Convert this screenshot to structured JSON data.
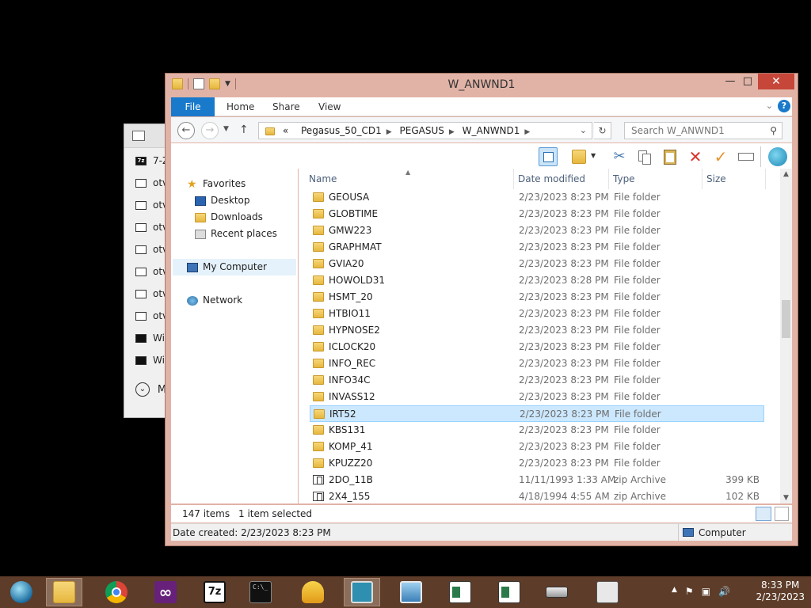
{
  "background_window": {
    "rows": [
      {
        "label": "7-Z",
        "icon": "7zip-icon"
      },
      {
        "label": "otv",
        "icon": "window-icon"
      },
      {
        "label": "otv",
        "icon": "window-icon"
      },
      {
        "label": "otv",
        "icon": "window-icon"
      },
      {
        "label": "otv",
        "icon": "window-icon"
      },
      {
        "label": "otv",
        "icon": "window-icon"
      },
      {
        "label": "otv",
        "icon": "window-icon"
      },
      {
        "label": "otv",
        "icon": "window-icon"
      },
      {
        "label": "Wi",
        "icon": "cmd-icon"
      },
      {
        "label": "Wi",
        "icon": "cmd-icon"
      }
    ],
    "more_label": "M"
  },
  "window": {
    "title": "W_ANWND1",
    "minimize": "—",
    "maximize": "□",
    "close": "✕",
    "accent": "#e1b2a6"
  },
  "ribbon": {
    "tabs": [
      "File",
      "Home",
      "Share",
      "View"
    ],
    "help": "?"
  },
  "address": {
    "overflow": "«",
    "segments": [
      "Pegasus_50_CD1",
      "PEGASUS",
      "W_ANWND1"
    ],
    "search_placeholder": "Search W_ANWND1"
  },
  "nav": {
    "favorites": "Favorites",
    "desktop": "Desktop",
    "downloads": "Downloads",
    "recent": "Recent places",
    "computer": "My Computer",
    "network": "Network"
  },
  "columns": {
    "name": "Name",
    "date": "Date modified",
    "type": "Type",
    "size": "Size"
  },
  "files": [
    {
      "name": "GEOUSA",
      "date": "2/23/2023 8:23 PM",
      "type": "File folder",
      "size": "",
      "kind": "folder"
    },
    {
      "name": "GLOBTIME",
      "date": "2/23/2023 8:23 PM",
      "type": "File folder",
      "size": "",
      "kind": "folder"
    },
    {
      "name": "GMW223",
      "date": "2/23/2023 8:23 PM",
      "type": "File folder",
      "size": "",
      "kind": "folder"
    },
    {
      "name": "GRAPHMAT",
      "date": "2/23/2023 8:23 PM",
      "type": "File folder",
      "size": "",
      "kind": "folder"
    },
    {
      "name": "GVIA20",
      "date": "2/23/2023 8:23 PM",
      "type": "File folder",
      "size": "",
      "kind": "folder"
    },
    {
      "name": "HOWOLD31",
      "date": "2/23/2023 8:28 PM",
      "type": "File folder",
      "size": "",
      "kind": "folder"
    },
    {
      "name": "HSMT_20",
      "date": "2/23/2023 8:23 PM",
      "type": "File folder",
      "size": "",
      "kind": "folder"
    },
    {
      "name": "HTBIO11",
      "date": "2/23/2023 8:23 PM",
      "type": "File folder",
      "size": "",
      "kind": "folder"
    },
    {
      "name": "HYPNOSE2",
      "date": "2/23/2023 8:23 PM",
      "type": "File folder",
      "size": "",
      "kind": "folder"
    },
    {
      "name": "ICLOCK20",
      "date": "2/23/2023 8:23 PM",
      "type": "File folder",
      "size": "",
      "kind": "folder"
    },
    {
      "name": "INFO_REC",
      "date": "2/23/2023 8:23 PM",
      "type": "File folder",
      "size": "",
      "kind": "folder"
    },
    {
      "name": "INFO34C",
      "date": "2/23/2023 8:23 PM",
      "type": "File folder",
      "size": "",
      "kind": "folder"
    },
    {
      "name": "INVASS12",
      "date": "2/23/2023 8:23 PM",
      "type": "File folder",
      "size": "",
      "kind": "folder"
    },
    {
      "name": "IRT52",
      "date": "2/23/2023 8:23 PM",
      "type": "File folder",
      "size": "",
      "kind": "folder",
      "selected": true
    },
    {
      "name": "KBS131",
      "date": "2/23/2023 8:23 PM",
      "type": "File folder",
      "size": "",
      "kind": "folder"
    },
    {
      "name": "KOMP_41",
      "date": "2/23/2023 8:23 PM",
      "type": "File folder",
      "size": "",
      "kind": "folder"
    },
    {
      "name": "KPUZZ20",
      "date": "2/23/2023 8:23 PM",
      "type": "File folder",
      "size": "",
      "kind": "folder"
    },
    {
      "name": "2DO_11B",
      "date": "11/11/1993 1:33 AM",
      "type": "zip Archive",
      "size": "399 KB",
      "kind": "zip"
    },
    {
      "name": "2X4_155",
      "date": "4/18/1994 4:55 AM",
      "type": "zip Archive",
      "size": "102 KB",
      "kind": "zip"
    }
  ],
  "status": {
    "items": "147 items",
    "selected": "1 item selected",
    "date_created": "Date created: 2/23/2023 8:23 PM",
    "computer": "Computer"
  },
  "taskbar": {
    "time": "8:33 PM",
    "date": "2/23/2023",
    "apps": [
      "start-icon",
      "file-explorer-icon",
      "chrome-icon",
      "visual-studio-icon",
      "7zip-icon",
      "cmd-icon",
      "shell-icon",
      "vdm-icon",
      "photo-viewer-icon",
      "document-icon",
      "document-icon",
      "drive-icon",
      "monitor-icon"
    ]
  }
}
